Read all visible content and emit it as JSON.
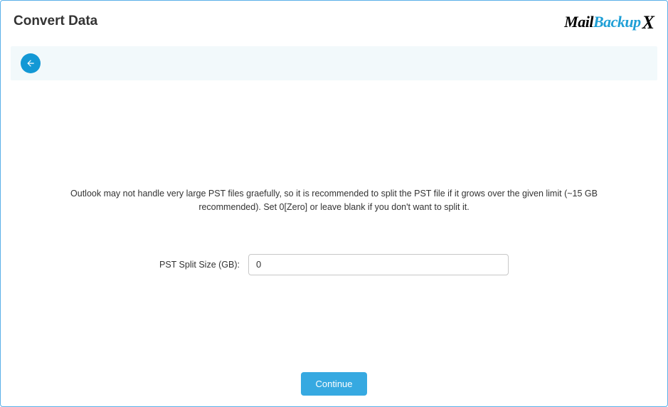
{
  "header": {
    "title": "Convert Data",
    "logo": {
      "mail": "Mail",
      "backup": "Backup",
      "x": "X"
    }
  },
  "content": {
    "description": "Outlook may not handle very large PST files graefully, so it is recommended to split the PST file if it grows over the given limit (~15 GB recommended). Set 0[Zero] or leave blank if you don't want to split it.",
    "split_label": "PST Split Size (GB):",
    "split_value": "0"
  },
  "footer": {
    "continue_label": "Continue"
  }
}
